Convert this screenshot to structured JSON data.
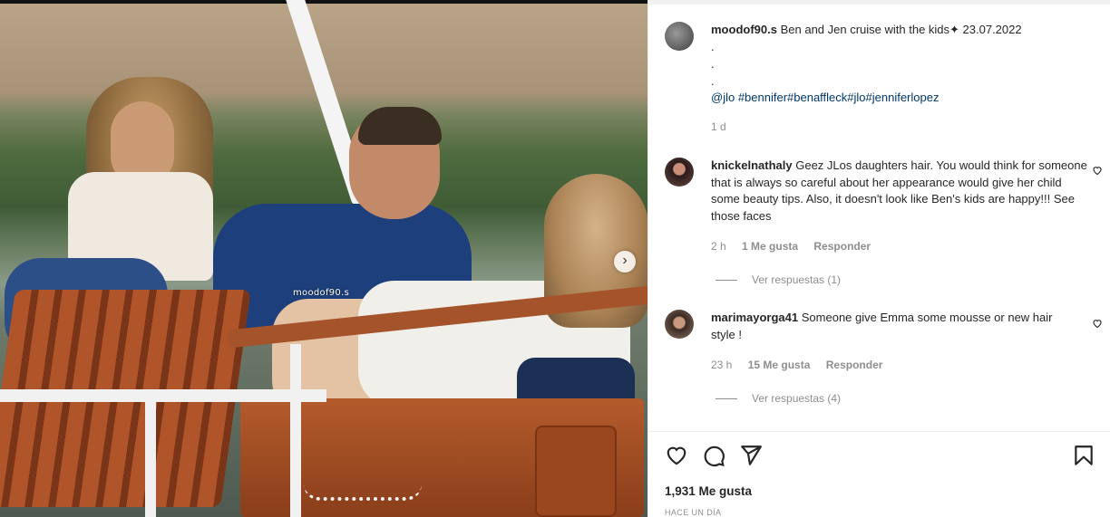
{
  "post": {
    "watermark": "moodof90.s",
    "owner": "moodof90.s",
    "caption": "Ben and Jen cruise with the kids✦ 23.07.2022",
    "dots": [
      ".",
      ".",
      "."
    ],
    "hashtags": "@jlo #bennifer#benaffleck#jlo#jenniferlopez",
    "time": "1 d",
    "likes": "1,931 Me gusta",
    "posted_ago": "HACE UN DÍA"
  },
  "comments": [
    {
      "user": "knickelnathaly",
      "text": "Geez JLos daughters hair. You would think for someone that is always so careful about her appearance would give her child some beauty tips. Also, it doesn't look like Ben's kids are happy!!! See those faces",
      "time": "2 h",
      "likes": "1 Me gusta",
      "reply": "Responder",
      "view_replies": "Ver respuestas (1)"
    },
    {
      "user": "marimayorga41",
      "text": "Someone give Emma some mousse or new hair style !",
      "time": "23 h",
      "likes": "15 Me gusta",
      "reply": "Responder",
      "view_replies": "Ver respuestas (4)"
    }
  ],
  "icons": {
    "next": "chevron-right-icon",
    "like": "heart-icon",
    "comment": "comment-icon",
    "share": "send-icon",
    "save": "bookmark-icon"
  },
  "colors": {
    "text": "#262626",
    "muted": "#8e8e8e",
    "hashtag": "#00376b"
  }
}
